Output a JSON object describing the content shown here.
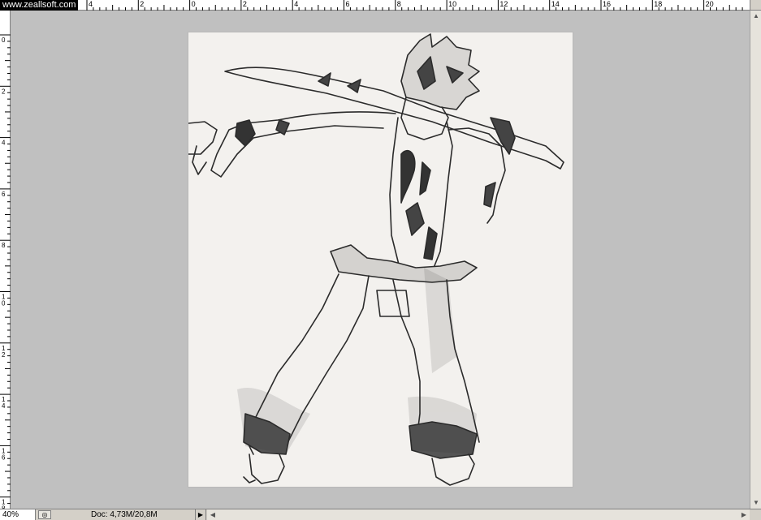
{
  "watermark": "www.zeallsoft.com",
  "ruler_top_labels": [
    "4",
    "2",
    "0",
    "2",
    "4",
    "6",
    "8",
    "10",
    "12",
    "14",
    "16",
    "18",
    "20"
  ],
  "ruler_left_labels": [
    "0",
    "2",
    "4",
    "6",
    "8",
    "10",
    "12",
    "14",
    "16",
    "18"
  ],
  "status": {
    "zoom": "40%",
    "doc_info": "Doc: 4,73M/20,8M",
    "menu_arrow": "▶"
  },
  "scroll_arrows": {
    "up": "▲",
    "down": "▼",
    "left": "◀",
    "right": "▶"
  },
  "icons": {
    "status_icon": "navigator-icon"
  },
  "colors": {
    "workspace": "#c0c0c0",
    "paper": "#f3f1ee",
    "pencil": "#2b2b2b"
  }
}
